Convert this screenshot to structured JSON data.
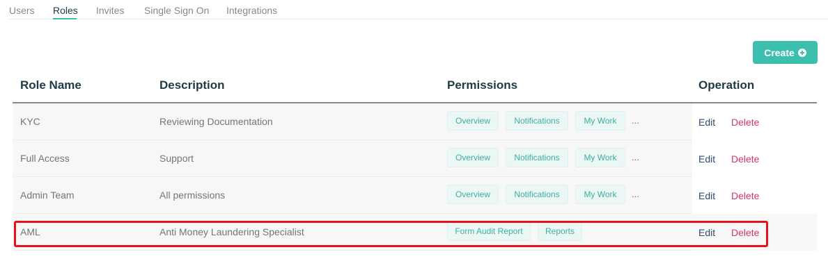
{
  "tabs": [
    {
      "label": "Users"
    },
    {
      "label": "Roles"
    },
    {
      "label": "Invites"
    },
    {
      "label": "Single Sign On"
    },
    {
      "label": "Integrations"
    }
  ],
  "active_tab": "Roles",
  "create_button": {
    "label": "Create",
    "icon": "plus-circle-icon"
  },
  "columns": [
    "Role Name",
    "Description",
    "Permissions",
    "Operation"
  ],
  "rows": [
    {
      "name": "KYC",
      "description": "Reviewing Documentation",
      "permissions": [
        "Overview",
        "Notifications",
        "My Work"
      ],
      "more": "...",
      "edit": "Edit",
      "delete": "Delete"
    },
    {
      "name": "Full Access",
      "description": "Support",
      "permissions": [
        "Overview",
        "Notifications",
        "My Work"
      ],
      "more": "...",
      "edit": "Edit",
      "delete": "Delete"
    },
    {
      "name": "Admin Team",
      "description": "All permissions",
      "permissions": [
        "Overview",
        "Notifications",
        "My Work"
      ],
      "more": "...",
      "edit": "Edit",
      "delete": "Delete"
    },
    {
      "name": "AML",
      "description": "Anti Money Laundering Specialist",
      "permissions": [
        "Form Audit Report",
        "Reports"
      ],
      "edit": "Edit",
      "delete": "Delete",
      "highlighted": true
    }
  ],
  "colors": {
    "accent": "#3dbfae",
    "delete": "#d6336c",
    "edit": "#2b4a6f",
    "highlight": "#e8101c"
  }
}
